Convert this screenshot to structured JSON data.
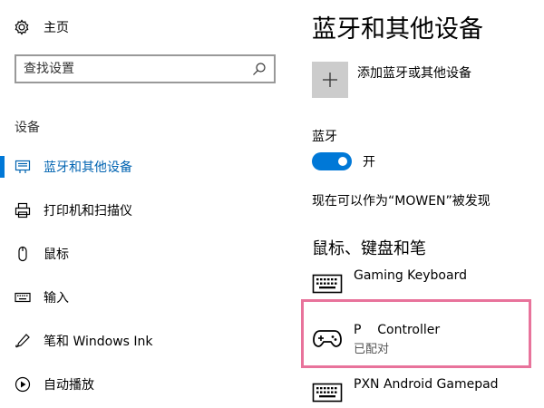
{
  "nav": {
    "home_label": "主页",
    "search_placeholder": "查找设置",
    "section_label": "设备",
    "items": [
      {
        "label": "蓝牙和其他设备",
        "icon": "bluetooth-devices-icon",
        "active": true
      },
      {
        "label": "打印机和扫描仪",
        "icon": "printer-icon",
        "active": false
      },
      {
        "label": "鼠标",
        "icon": "mouse-icon",
        "active": false
      },
      {
        "label": "输入",
        "icon": "keyboard-icon",
        "active": false
      },
      {
        "label": "笔和 Windows Ink",
        "icon": "pen-icon",
        "active": false
      },
      {
        "label": "自动播放",
        "icon": "autoplay-icon",
        "active": false
      }
    ]
  },
  "main": {
    "title": "蓝牙和其他设备",
    "add_device_label": "添加蓝牙或其他设备",
    "bluetooth_label": "蓝牙",
    "bluetooth_state": "开",
    "bluetooth_on": true,
    "discoverable_text": "现在可以作为“MOWEN”被发现",
    "section_title": "鼠标、键盘和笔",
    "devices": [
      {
        "name": "Gaming Keyboard",
        "status": "",
        "icon": "keyboard-icon"
      },
      {
        "name": "P    Controller",
        "status": "已配对",
        "icon": "gamepad-icon"
      },
      {
        "name": "PXN Android Gamepad",
        "status": "",
        "icon": "keyboard-icon"
      }
    ]
  },
  "colors": {
    "accent": "#0078d7",
    "active_text": "#0063b1",
    "highlight_border": "#e8739b",
    "add_tile": "#cccccc"
  }
}
